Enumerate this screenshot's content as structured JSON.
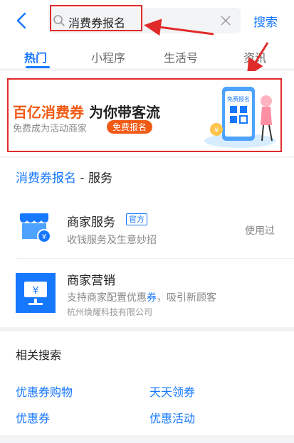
{
  "search": {
    "query": "消费券报名",
    "submit_label": "搜索"
  },
  "tabs": [
    "热门",
    "小程序",
    "生活号",
    "资讯"
  ],
  "banner": {
    "title_highlight": "百亿消费券",
    "title_rest": "为你带客流",
    "subtitle": "免费成为活动商家",
    "badge": "免费报名",
    "poster_label": "免费报名"
  },
  "service_section": {
    "title_link": "消费券报名",
    "title_suffix": " - 服务"
  },
  "items": [
    {
      "name": "商家服务",
      "tag": "官方",
      "desc": "收钱服务及生意妙招",
      "meta": "使用过",
      "icon": "shop-icon"
    },
    {
      "name": "商家营销",
      "desc_prefix": "支持商家配置优惠",
      "desc_highlight": "券",
      "desc_suffix": "，吸引新顾客",
      "company": "杭州焕耀科技有限公司",
      "icon": "marketing-icon"
    }
  ],
  "related": {
    "title": "相关搜索",
    "items": [
      "优惠券购物",
      "天天领券",
      "优惠券",
      "优惠活动"
    ]
  },
  "colors": {
    "accent": "#1677ff",
    "highlight": "#f05a14",
    "annotation": "#e02b2b"
  }
}
